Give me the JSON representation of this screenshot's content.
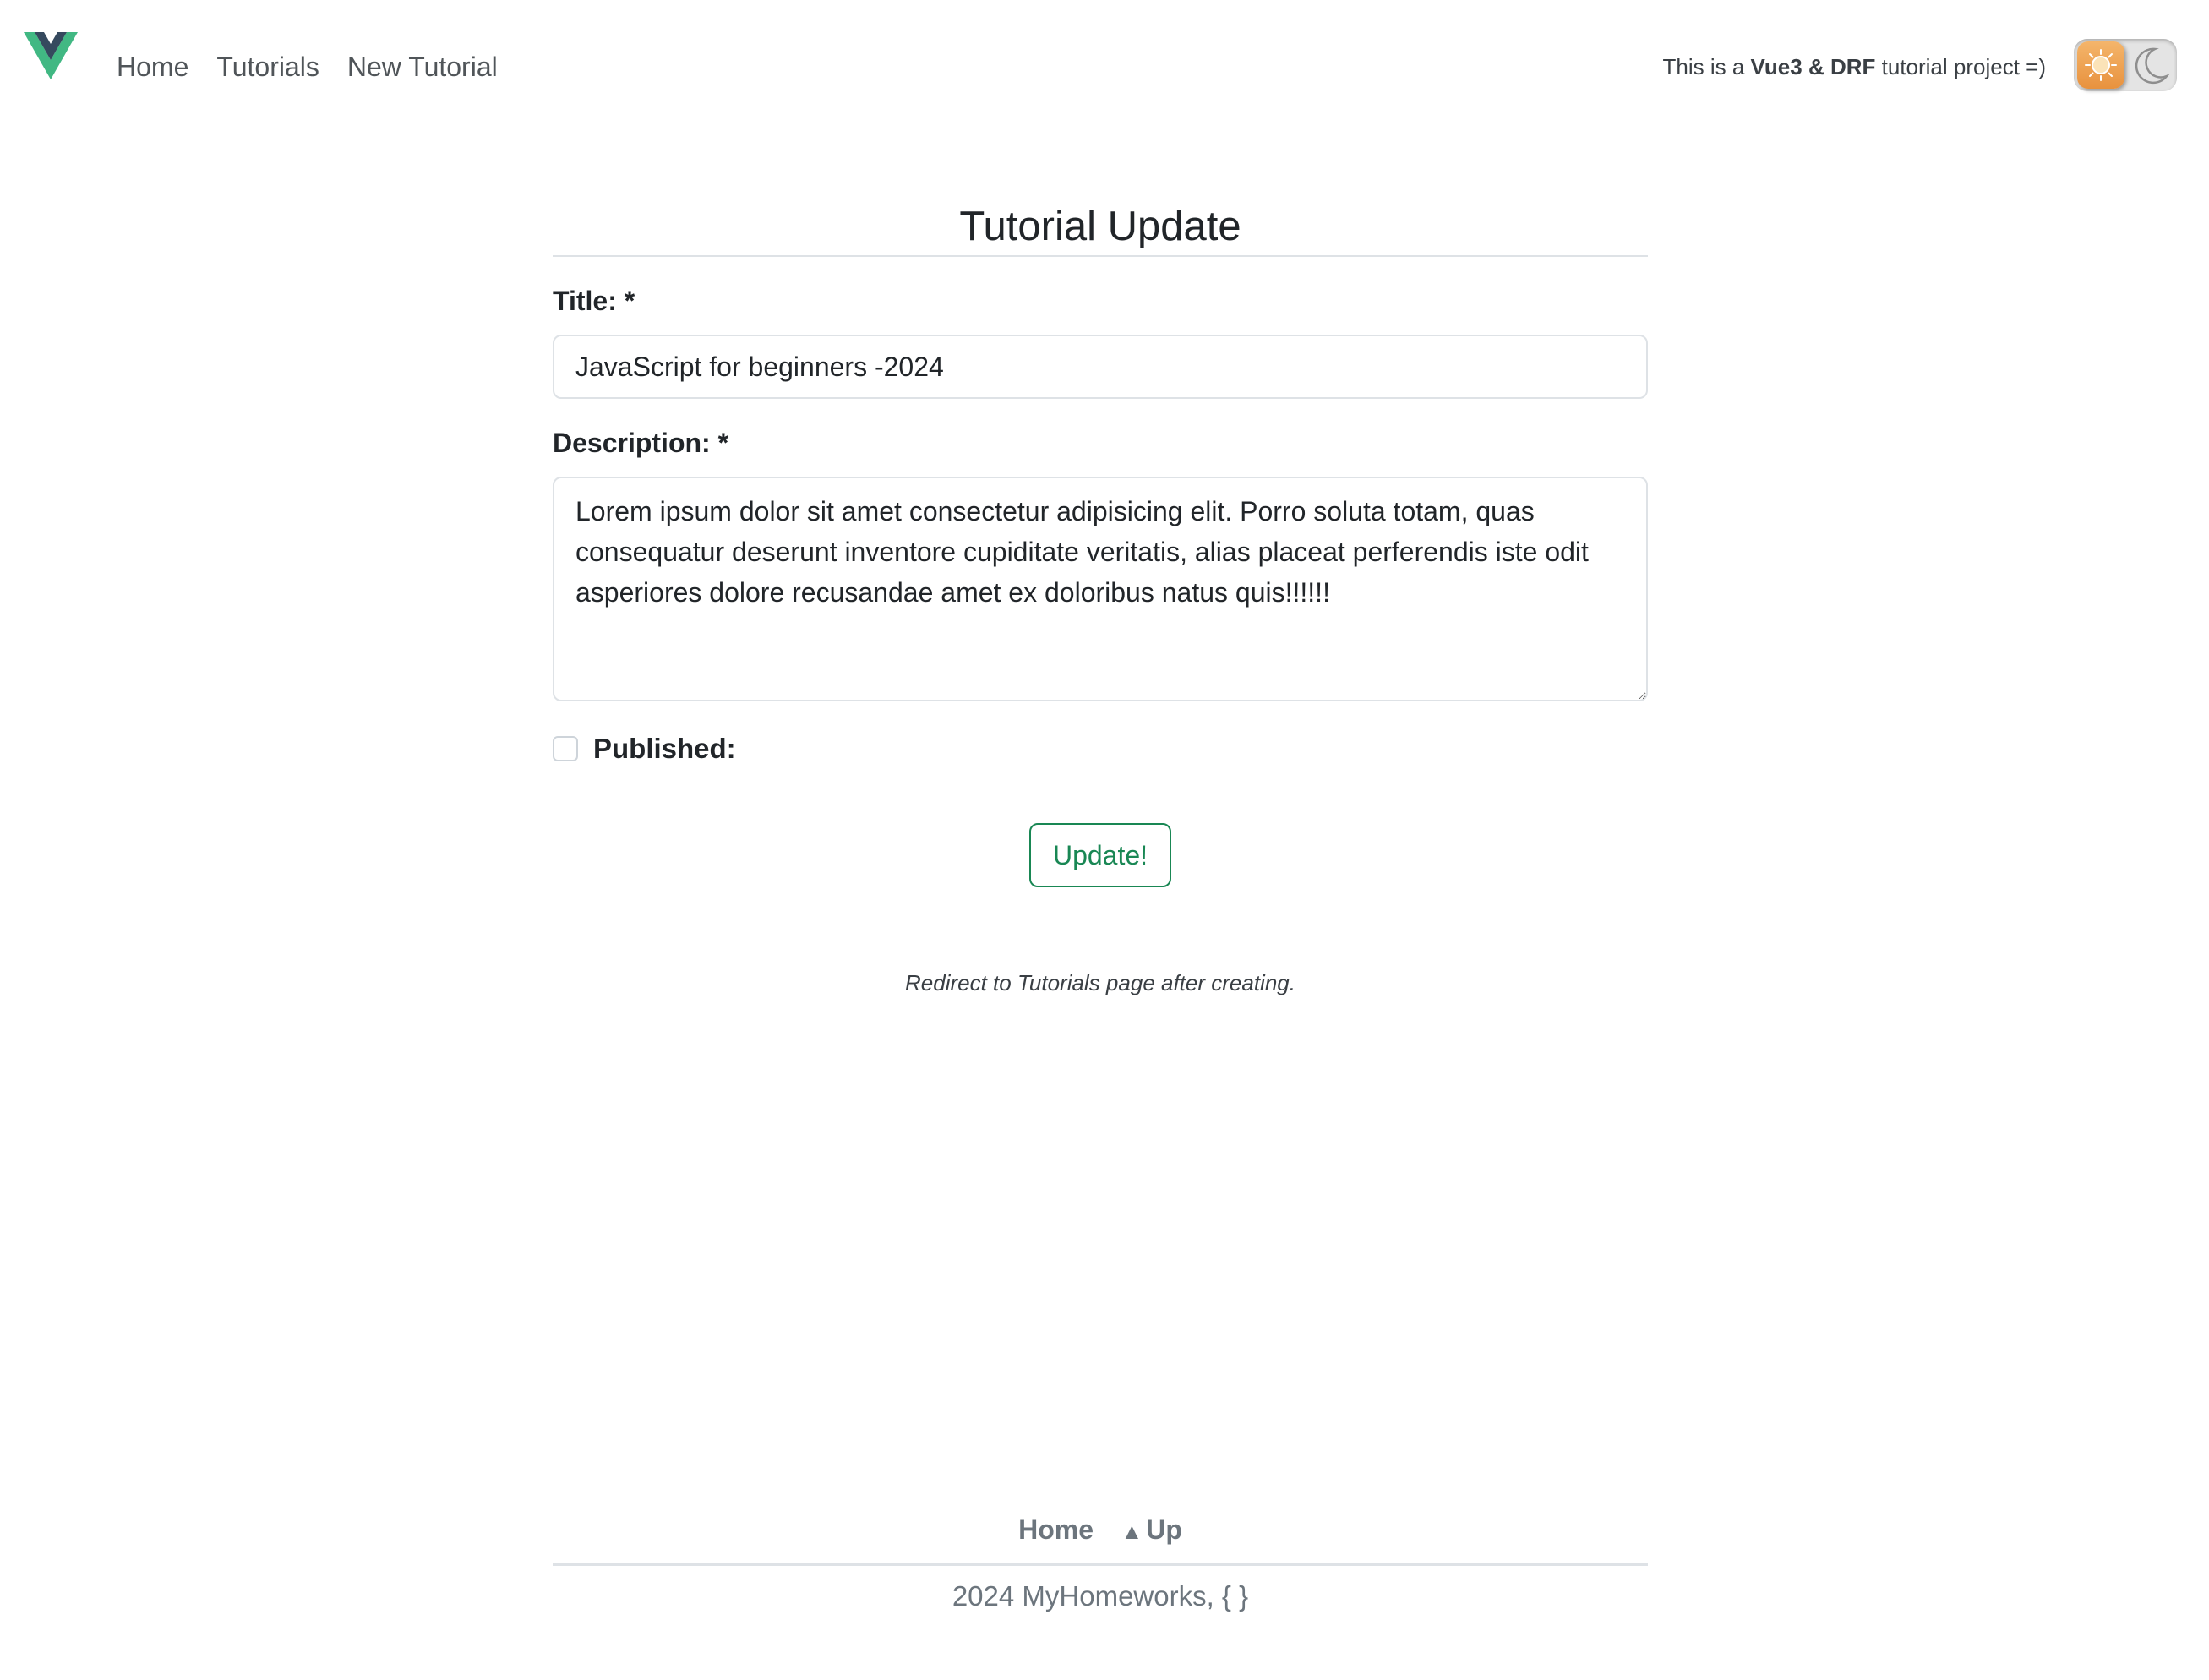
{
  "header": {
    "logo_icon": "vue-logo-icon",
    "nav": [
      {
        "label": "Home"
      },
      {
        "label": "Tutorials"
      },
      {
        "label": "New Tutorial"
      }
    ],
    "tagline": {
      "prefix": "This is a",
      "highlight": "Vue3 & DRF",
      "suffix": "tutorial project =)"
    },
    "theme_toggle": {
      "light_icon": "sun-icon",
      "dark_icon": "moon-icon"
    }
  },
  "form": {
    "heading": "Tutorial Update",
    "title_label": "Title: *",
    "title_value": "JavaScript for beginners -2024",
    "description_label": "Description: *",
    "description_value": "Lorem ipsum dolor sit amet consectetur adipisicing elit. Porro soluta totam, quas consequatur deserunt inventore cupiditate veritatis, alias placeat perferendis iste odit asperiores dolore recusandae amet ex doloribus natus quis!!!!!!",
    "published_label": "Published:",
    "published_checked": false,
    "submit_label": "Update!",
    "note": "Redirect to Tutorials page after creating."
  },
  "footer": {
    "home_label": "Home",
    "up_label": "Up",
    "up_icon": "up-arrow-icon",
    "copyright": "2024 MyHomeworks, { }"
  },
  "colors": {
    "accent_green": "#198754",
    "toggle_orange": "#e8923e"
  }
}
